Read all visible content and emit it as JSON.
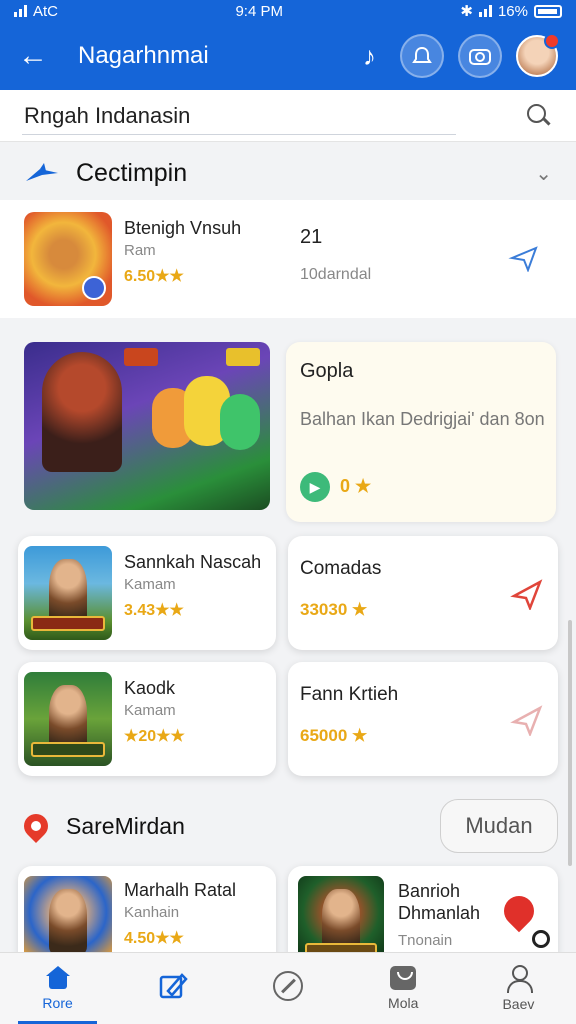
{
  "status": {
    "carrier": "AtC",
    "time": "9:4 PM",
    "battery": "16%"
  },
  "appbar": {
    "title": "Nagarhnmai",
    "back_icon": "back-arrow-icon",
    "music_icon": "music-note-icon",
    "bell_icon": "bell-icon",
    "camera_icon": "camera-icon"
  },
  "search": {
    "value": "Rngah Indanasin"
  },
  "section": {
    "title": "Cectimpin",
    "icon": "pinwheel-icon"
  },
  "top_item": {
    "name": "Btenigh Vnsuh",
    "sub": "Ram",
    "rating": "6.50★★",
    "count": "21",
    "meta": "10darndal"
  },
  "feature": {
    "title": "Gopla",
    "desc": "Balhan Ikan Dedrigjai' dan 8on",
    "rating": "0 ★"
  },
  "grid": [
    {
      "name": "Sannkah Nascah",
      "sub": "Kamam",
      "rating": "3.43★★"
    },
    {
      "name": "Comadas",
      "rating": "33030 ★"
    },
    {
      "name": "Kaodk",
      "sub": "Kamam",
      "rating": "★20★★"
    },
    {
      "name": "Fann Krtieh",
      "rating": "65000 ★"
    }
  ],
  "recommend": {
    "title": "SareMirdan",
    "button": "Mudan"
  },
  "rec_items": [
    {
      "name": "Marhalh Ratal",
      "sub": "Kanhain",
      "rating": "4.50★★"
    },
    {
      "name": "Banrioh Dhmanlah",
      "sub": "Tnonain"
    }
  ],
  "nav": [
    {
      "label": "Rore"
    },
    {
      "label": ""
    },
    {
      "label": ""
    },
    {
      "label": "Mola"
    },
    {
      "label": "Baev"
    }
  ],
  "colors": {
    "primary": "#1565d8",
    "star": "#e9a816",
    "accent_red": "#e0302a"
  }
}
